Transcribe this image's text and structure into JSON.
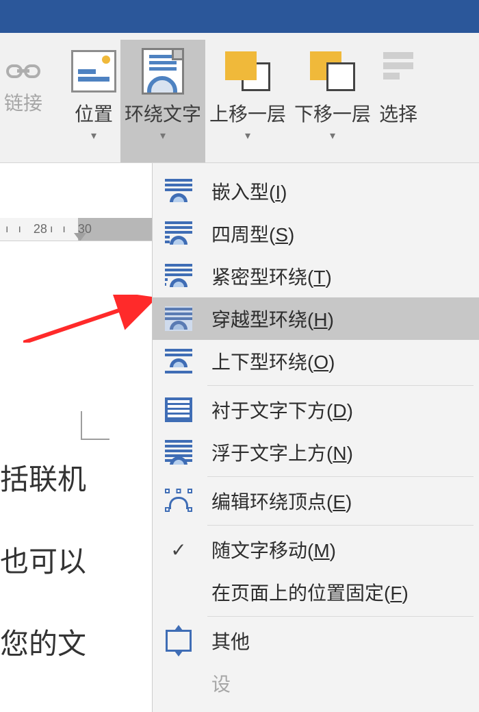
{
  "ribbon": {
    "link": {
      "label": "链接"
    },
    "position": {
      "label": "位置"
    },
    "wrap_text": {
      "label": "环绕文字"
    },
    "bring_forward": {
      "label": "上移一层"
    },
    "send_backward": {
      "label": "下移一层"
    },
    "selection_pane": {
      "label": "选择"
    }
  },
  "ruler": {
    "num1": "28",
    "num2": "30"
  },
  "doc": {
    "line1": "括联机",
    "line2": "也可以",
    "line3": "您的文"
  },
  "menu": {
    "inline": {
      "label": "嵌入型(",
      "hotkey": "I",
      "tail": ")"
    },
    "square": {
      "label": "四周型(",
      "hotkey": "S",
      "tail": ")"
    },
    "tight": {
      "label": "紧密型环绕(",
      "hotkey": "T",
      "tail": ")"
    },
    "through": {
      "label": "穿越型环绕(",
      "hotkey": "H",
      "tail": ")"
    },
    "top_bottom": {
      "label": "上下型环绕(",
      "hotkey": "O",
      "tail": ")"
    },
    "behind": {
      "label": "衬于文字下方(",
      "hotkey": "D",
      "tail": ")"
    },
    "front": {
      "label": "浮于文字上方(",
      "hotkey": "N",
      "tail": ")"
    },
    "edit_points": {
      "label": "编辑环绕顶点(",
      "hotkey": "E",
      "tail": ")"
    },
    "move_with_text": {
      "label": "随文字移动(",
      "hotkey": "M",
      "tail": ")"
    },
    "fix_on_page": {
      "label": "在页面上的位置固定(",
      "hotkey": "F",
      "tail": ")"
    },
    "more": {
      "label": "其他"
    },
    "set_default": {
      "label": "设"
    }
  }
}
